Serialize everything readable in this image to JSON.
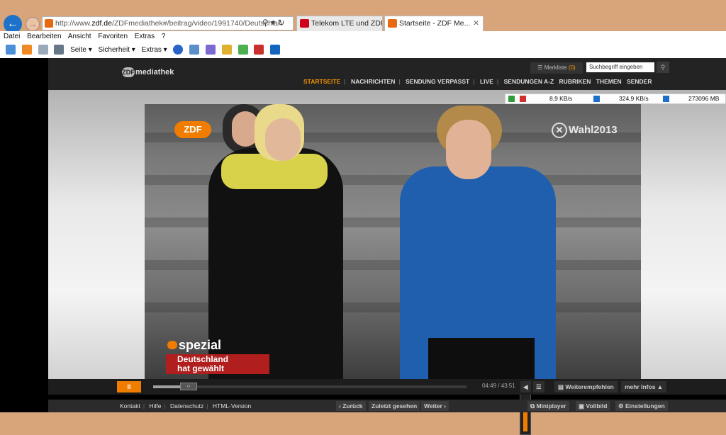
{
  "browser": {
    "address_prefix": "http://www.",
    "address_domain": "zdf.de",
    "address_path": "/ZDFmediathek#/beitrag/video/1991740/Deutschlan",
    "tabs": [
      {
        "label": "Telekom LTE und ZDF ..."
      },
      {
        "label": "Startseite - ZDF Me...",
        "close": "✕"
      }
    ],
    "menu": [
      "Datei",
      "Bearbeiten",
      "Ansicht",
      "Favoriten",
      "Extras",
      "?"
    ],
    "commands": {
      "seite": "Seite ▾",
      "sicherheit": "Sicherheit ▾",
      "extras": "Extras ▾"
    }
  },
  "site": {
    "logo_text": "mediathek",
    "logo_mark": "ZDF",
    "merkliste_label": "Merkliste",
    "merkliste_count": "(0)",
    "search_placeholder": "Suchbegriff eingeben",
    "nav": [
      "STARTSEITE",
      "NACHRICHTEN",
      "SENDUNG VERPASST",
      "LIVE",
      "SENDUNGEN A-Z",
      "RUBRIKEN",
      "THEMEN",
      "SENDER"
    ]
  },
  "netmeter": {
    "download": "8,9 KB/s",
    "upload": "324,9 KB/s",
    "total": "273096 MB"
  },
  "video": {
    "channel_logo": "ZDF",
    "wahl_label": "Wahl2013",
    "spezial_label": "spezial",
    "caption_line1": "Deutschland",
    "caption_line2": "hat gewählt",
    "progress": 0.11,
    "volume": 0.8
  },
  "controls": {
    "play_label": "II",
    "time": "04:49 / 43:51",
    "weiterempfehlen": "Weiterempfehlen",
    "mehr_infos": "mehr Infos ▲"
  },
  "footer": {
    "links": [
      "Kontakt",
      "Hilfe",
      "Datenschutz",
      "HTML-Version"
    ],
    "zurueck": "‹ Zurück",
    "zuletzt": "Zuletzt gesehen",
    "weiter": "Weiter ›",
    "miniplayer": "Miniplayer",
    "vollbild": "Vollbild",
    "einstellungen": "Einstellungen"
  }
}
